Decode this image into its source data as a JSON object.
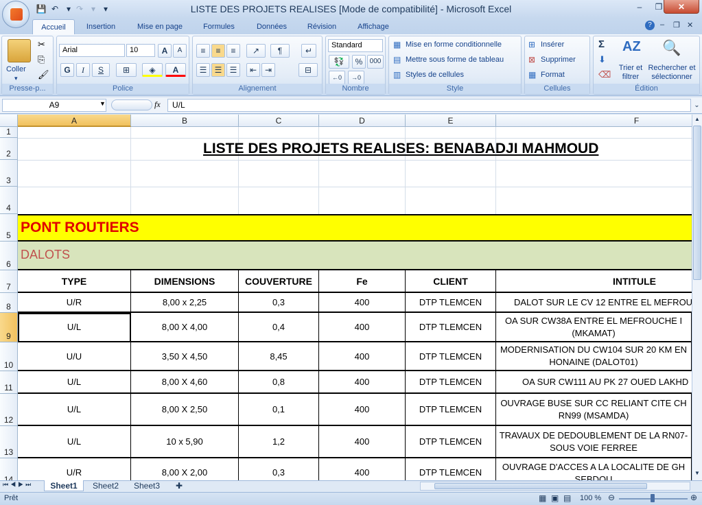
{
  "window": {
    "title": "LISTE DES PROJETS REALISES  [Mode de compatibilité] - Microsoft Excel",
    "minimize": "–",
    "maximize": "❐",
    "close": "✕"
  },
  "ribbon_tabs": [
    "Accueil",
    "Insertion",
    "Mise en page",
    "Formules",
    "Données",
    "Révision",
    "Affichage"
  ],
  "ribbon": {
    "clipboard": {
      "paste": "Coller",
      "label": "Presse-p..."
    },
    "font": {
      "name": "Arial",
      "size": "10",
      "bold": "G",
      "italic": "I",
      "underline": "S",
      "grow": "A",
      "shrink": "A",
      "label": "Police"
    },
    "alignment": {
      "label": "Alignement"
    },
    "number": {
      "format": "Standard",
      "percent": "%",
      "thousands": "000",
      "label": "Nombre"
    },
    "style": {
      "conditional": "Mise en forme conditionnelle",
      "table": "Mettre sous forme de tableau",
      "cell_styles": "Styles de cellules",
      "label": "Style"
    },
    "cells": {
      "insert": "Insérer",
      "delete": "Supprimer",
      "format": "Format",
      "label": "Cellules"
    },
    "editing": {
      "sigma": "Σ",
      "sort": "Trier et filtrer",
      "find": "Rechercher et sélectionner",
      "label": "Édition"
    }
  },
  "formula_bar": {
    "name_box": "A9",
    "fx": "fx",
    "content": "U/L"
  },
  "columns": [
    "A",
    "B",
    "C",
    "D",
    "E",
    "F"
  ],
  "sheet": {
    "title": "LISTE DES PROJETS REALISES: BENABADJI MAHMOUD",
    "section": "PONT ROUTIERS",
    "subsection": "DALOTS",
    "headers": [
      "TYPE",
      "DIMENSIONS",
      "COUVERTURE",
      "Fe",
      "CLIENT",
      "INTITULE"
    ],
    "rows": [
      {
        "row": "8",
        "type": "U/R",
        "dimensions": "8,00 x 2,25",
        "couverture": "0,3",
        "fe": "400",
        "client": "DTP TLEMCEN",
        "intitule": "DALOT SUR LE CV 12 ENTRE EL MEFROU"
      },
      {
        "row": "9",
        "type": "U/L",
        "dimensions": "8,00 X 4,00",
        "couverture": "0,4",
        "fe": "400",
        "client": "DTP TLEMCEN",
        "intitule": "OA SUR CW38A ENTRE EL MEFROUCHE I (MKAMAT)"
      },
      {
        "row": "10",
        "type": "U/U",
        "dimensions": "3,50 X 4,50",
        "couverture": "8,45",
        "fe": "400",
        "client": "DTP TLEMCEN",
        "intitule": "MODERNISATION DU CW104 SUR 20 KM EN HONAINE (DALOT01)"
      },
      {
        "row": "11",
        "type": "U/L",
        "dimensions": "8,00 X 4,60",
        "couverture": "0,8",
        "fe": "400",
        "client": "DTP TLEMCEN",
        "intitule": "OA SUR CW111 AU PK 27 OUED LAKHD"
      },
      {
        "row": "12",
        "type": "U/L",
        "dimensions": "8,00 X 2,50",
        "couverture": "0,1",
        "fe": "400",
        "client": "DTP TLEMCEN",
        "intitule": "OUVRAGE BUSE SUR CC RELIANT CITE CH RN99 (MSAMDA)"
      },
      {
        "row": "13",
        "type": "U/L",
        "dimensions": "10 x 5,90",
        "couverture": "1,2",
        "fe": "400",
        "client": "DTP TLEMCEN",
        "intitule": "TRAVAUX DE DEDOUBLEMENT DE LA RN07- SOUS VOIE FERREE"
      },
      {
        "row": "14",
        "type": "U/R",
        "dimensions": "8,00 X 2,00",
        "couverture": "0,3",
        "fe": "400",
        "client": "DTP TLEMCEN",
        "intitule": "OUVRAGE D'ACCES A LA LOCALITE DE GH SEBDOU"
      }
    ]
  },
  "sheet_tabs": [
    "Sheet1",
    "Sheet2",
    "Sheet3"
  ],
  "status": {
    "ready": "Prêt",
    "zoom": "100 %"
  },
  "colors": {
    "section_bg": "#ffff00",
    "section_text": "#e00000",
    "subsection_bg": "#d8e4bc",
    "subsection_text": "#c0504d"
  }
}
